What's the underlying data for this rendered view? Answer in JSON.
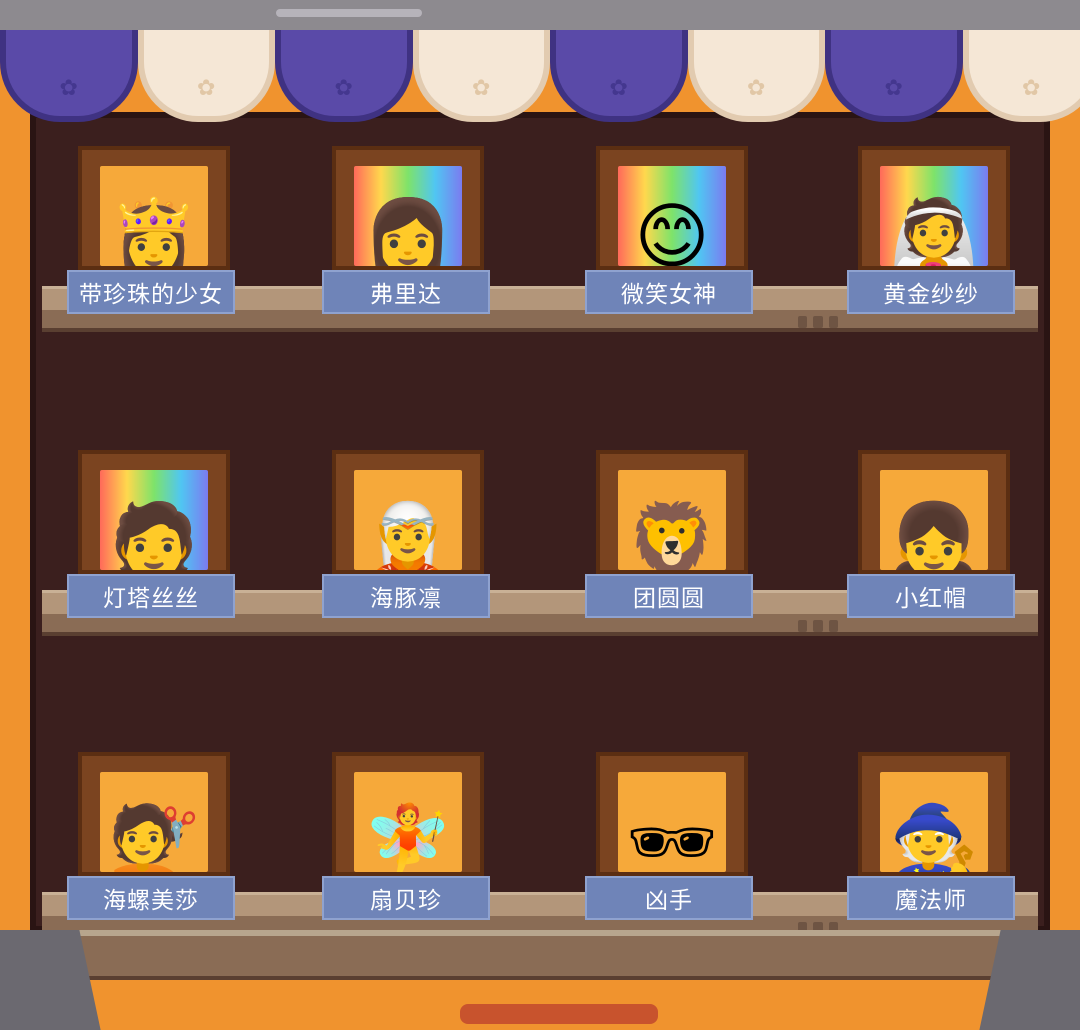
{
  "shelves": [
    {
      "items": [
        {
          "name": "带珍珠的少女",
          "bg": "orange",
          "icon": "girl-pearl-avatar"
        },
        {
          "name": "弗里达",
          "bg": "rainbow",
          "icon": "frida-avatar"
        },
        {
          "name": "微笑女神",
          "bg": "rainbow",
          "icon": "smiling-goddess-avatar"
        },
        {
          "name": "黄金纱纱",
          "bg": "rainbow",
          "icon": "golden-veil-avatar"
        }
      ]
    },
    {
      "items": [
        {
          "name": "灯塔丝丝",
          "bg": "rainbow",
          "icon": "lighthouse-avatar"
        },
        {
          "name": "海豚凛",
          "bg": "orange",
          "icon": "dolphin-avatar"
        },
        {
          "name": "团圆圆",
          "bg": "orange",
          "icon": "lion-dance-avatar"
        },
        {
          "name": "小红帽",
          "bg": "orange",
          "icon": "red-hood-avatar"
        }
      ]
    },
    {
      "items": [
        {
          "name": "海螺美莎",
          "bg": "orange",
          "icon": "conch-avatar"
        },
        {
          "name": "扇贝珍",
          "bg": "orange",
          "icon": "scallop-avatar"
        },
        {
          "name": "凶手",
          "bg": "orange",
          "icon": "killer-avatar"
        },
        {
          "name": "魔法师",
          "bg": "orange",
          "icon": "witch-avatar"
        }
      ]
    }
  ],
  "colors": {
    "label_bg": "#6f84b8",
    "cabinet_bg": "#3b1f1e",
    "frame": "#7b4420"
  }
}
